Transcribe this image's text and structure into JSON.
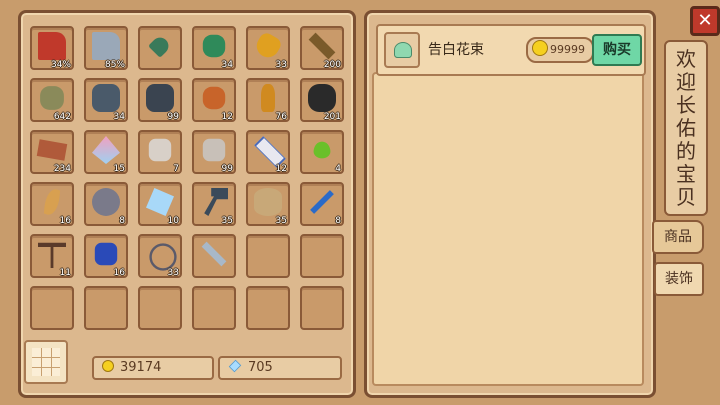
{
  "inventory": {
    "slots": [
      {
        "icon": "axe-icon",
        "count": "34%"
      },
      {
        "icon": "steel-axe-icon",
        "count": "85%"
      },
      {
        "icon": "shovel-icon",
        "count": ""
      },
      {
        "icon": "green-rope-icon",
        "count": "34"
      },
      {
        "icon": "golden-fruit-icon",
        "count": "33"
      },
      {
        "icon": "wood-branch-icon",
        "count": "200"
      },
      {
        "icon": "stone-icon",
        "count": "642"
      },
      {
        "icon": "iron-ore-icon",
        "count": "34"
      },
      {
        "icon": "coal-ore-icon",
        "count": "99"
      },
      {
        "icon": "copper-ore-icon",
        "count": "12"
      },
      {
        "icon": "bottle-icon",
        "count": "76"
      },
      {
        "icon": "coal-icon",
        "count": "201"
      },
      {
        "icon": "plank-icon",
        "count": "234"
      },
      {
        "icon": "crystal-icon",
        "count": "15"
      },
      {
        "icon": "rock-icon",
        "count": "7"
      },
      {
        "icon": "gravel-icon",
        "count": "99"
      },
      {
        "icon": "tube-icon",
        "count": "12"
      },
      {
        "icon": "green-drop-icon",
        "count": "4"
      },
      {
        "icon": "feather-icon",
        "count": "16"
      },
      {
        "icon": "bag-icon",
        "count": "8"
      },
      {
        "icon": "ice-crystal-icon",
        "count": "10"
      },
      {
        "icon": "hammer-icon",
        "count": "35"
      },
      {
        "icon": "log-icon",
        "count": "35"
      },
      {
        "icon": "screwdriver-icon",
        "count": "8"
      },
      {
        "icon": "pickaxe-icon",
        "count": "11"
      },
      {
        "icon": "blue-claw-icon",
        "count": "16"
      },
      {
        "icon": "rope-icon",
        "count": "33"
      },
      {
        "icon": "sword-icon",
        "count": ""
      },
      {
        "icon": "",
        "count": ""
      },
      {
        "icon": "",
        "count": ""
      },
      {
        "icon": "",
        "count": ""
      },
      {
        "icon": "",
        "count": ""
      },
      {
        "icon": "",
        "count": ""
      },
      {
        "icon": "",
        "count": ""
      },
      {
        "icon": "",
        "count": ""
      },
      {
        "icon": "",
        "count": ""
      }
    ]
  },
  "currency": {
    "gold": "39174",
    "gems": "705"
  },
  "shop": {
    "item_name": "告白花束",
    "item_price": "99999",
    "buy_label": "购买",
    "welcome_text": "欢迎长佑的宝贝",
    "tabs": [
      "商品",
      "装饰"
    ]
  },
  "colors": {
    "panel": "#dcb88e",
    "border": "#7a4f32",
    "buy_button": "#6fd7a6",
    "close": "#c0392b"
  }
}
